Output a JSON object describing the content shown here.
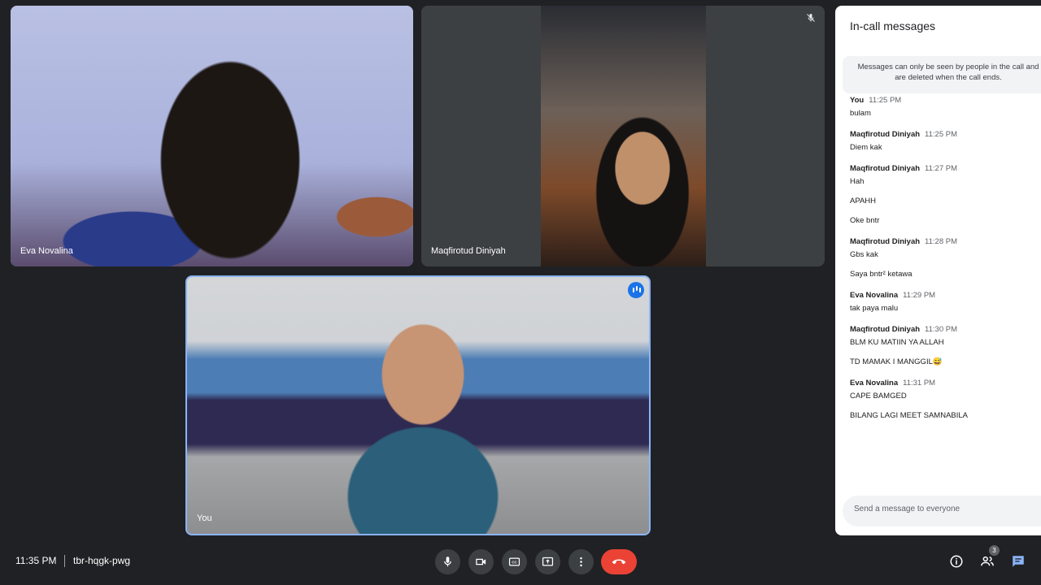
{
  "participants": [
    {
      "name": "Eva Novalina"
    },
    {
      "name": "Maqfirotud Diniyah"
    },
    {
      "name": "You"
    }
  ],
  "panel": {
    "title": "In-call messages",
    "notice_line1": "Messages can only be seen by people in the call and",
    "notice_line2": "are deleted when the call ends.",
    "messages": [
      {
        "sender": "You",
        "time": "11:25 PM",
        "lines": [
          "bulam"
        ]
      },
      {
        "sender": "Maqfirotud Diniyah",
        "time": "11:25 PM",
        "lines": [
          "Diem kak"
        ]
      },
      {
        "sender": "Maqfirotud Diniyah",
        "time": "11:27 PM",
        "lines": [
          "Hah",
          "APAHH",
          "Oke bntr"
        ]
      },
      {
        "sender": "Maqfirotud Diniyah",
        "time": "11:28 PM",
        "lines": [
          "Gbs kak",
          "Saya bntr² ketawa"
        ]
      },
      {
        "sender": "Eva Novalina",
        "time": "11:29 PM",
        "lines": [
          "tak paya malu"
        ]
      },
      {
        "sender": "Maqfirotud Diniyah",
        "time": "11:30 PM",
        "lines": [
          "BLM KU MATIIN YA ALLAH",
          "TD MAMAK I MANGGIL😅"
        ]
      },
      {
        "sender": "Eva Novalina",
        "time": "11:31 PM",
        "lines": [
          "CAPE BAMGED",
          "BILANG LAGI MEET SAMNABILA"
        ]
      }
    ],
    "composer_placeholder": "Send a message to everyone"
  },
  "bottom_bar": {
    "time": "11:35 PM",
    "meeting_code": "tbr-hqgk-pwg",
    "people_count": "3"
  },
  "colors": {
    "background": "#202124",
    "end_call": "#ea4335",
    "active_speaker_border": "#8ab4f8",
    "chat_accent": "#1a73e8"
  }
}
